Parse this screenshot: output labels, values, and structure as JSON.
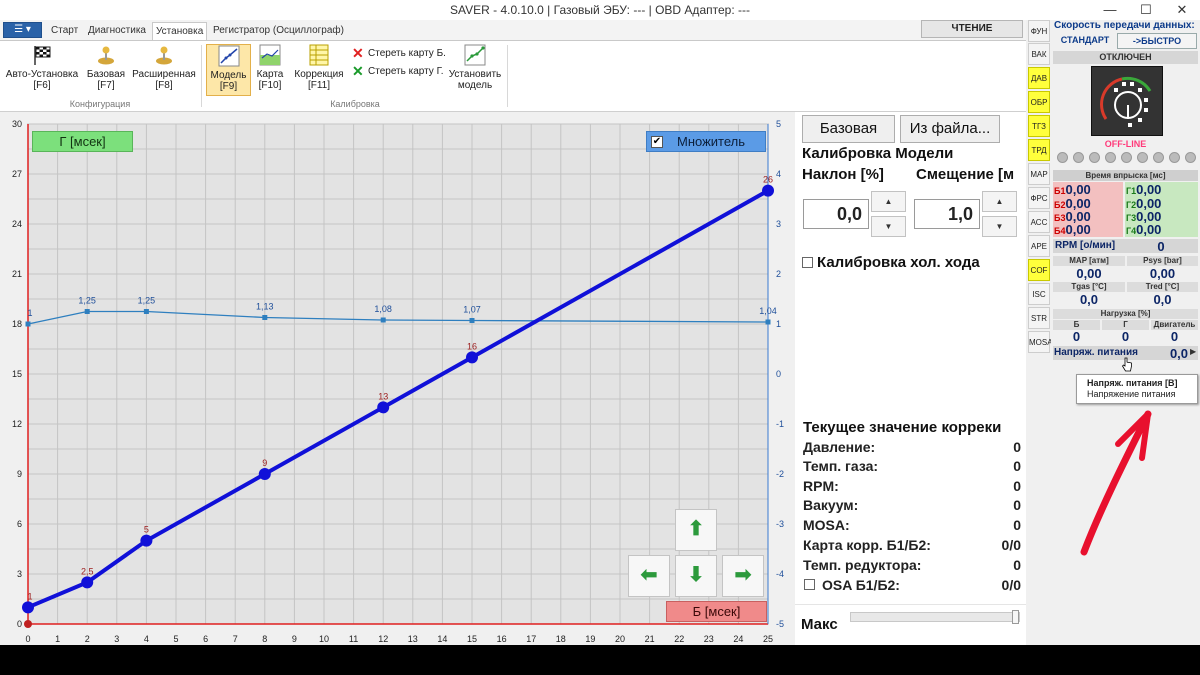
{
  "window": {
    "title": "SAVER - 4.0.10.0  |  Газовый ЭБУ: ---  |  OBD Адаптер: ---",
    "minimize": "—",
    "maximize": "☐",
    "close": "✕"
  },
  "menu": {
    "tabs": [
      "Старт",
      "Диагностика",
      "Установка",
      "Регистратор (Осциллограф)"
    ],
    "read_button": "ЧТЕНИЕ"
  },
  "ribbon": {
    "config_group": "Конфигурация",
    "calib_group": "Калибровка",
    "auto_setup": [
      "Авто-Установка",
      "[F6]"
    ],
    "basic": [
      "Базовая",
      "[F7]"
    ],
    "extended": [
      "Расширенная",
      "[F8]"
    ],
    "model": [
      "Модель",
      "[F9]"
    ],
    "map": [
      "Карта",
      "[F10]"
    ],
    "correction": [
      "Коррекция",
      "[F11]"
    ],
    "erase_b": "Стереть карту Б.",
    "erase_g": "Стереть карту Г.",
    "set_model": [
      "Установить",
      "модель"
    ]
  },
  "chart_labels": {
    "g_axis": "Г [мсек]",
    "b_axis": "Б [мсек]",
    "multiplier": "Множитель",
    "multiplier_checked": "✔"
  },
  "chart_data": {
    "type": "line",
    "xlabel": "Б [мсек]",
    "ylabel": "Г [мсек]",
    "y2label": "Множитель",
    "xlim": [
      0,
      25
    ],
    "ylim": [
      0,
      30
    ],
    "y2lim": [
      -5,
      5
    ],
    "x_ticks": [
      0,
      1,
      2,
      3,
      4,
      5,
      6,
      7,
      8,
      9,
      10,
      11,
      12,
      13,
      14,
      15,
      16,
      17,
      18,
      19,
      20,
      21,
      22,
      23,
      24,
      25
    ],
    "y_ticks": [
      0,
      3,
      6,
      9,
      12,
      15,
      18,
      21,
      24,
      27,
      30
    ],
    "y2_ticks": [
      -5,
      -4,
      -3,
      -2,
      -1,
      0,
      1,
      2,
      3,
      4,
      5
    ],
    "grid": true,
    "series": [
      {
        "name": "Г [мсек]",
        "axis": "left",
        "color": "#1010d8",
        "x": [
          0,
          2,
          4,
          8,
          12,
          15,
          25
        ],
        "y": [
          1,
          2.5,
          5,
          9,
          13,
          16,
          26
        ],
        "labels": [
          "1",
          "2,5",
          "5",
          "9",
          "13",
          "16",
          "26"
        ]
      },
      {
        "name": "Множитель",
        "axis": "right",
        "color": "#2e7fbf",
        "x": [
          0,
          2,
          4,
          8,
          12,
          15,
          25
        ],
        "y": [
          1,
          1.25,
          1.25,
          1.13,
          1.08,
          1.07,
          1.04
        ],
        "labels": [
          "1",
          "1,25",
          "1,25",
          "1,13",
          "1,08",
          "1,07",
          "1,04"
        ]
      }
    ]
  },
  "nav_buttons": {
    "up": "⬆",
    "left": "⬅",
    "down": "⬇",
    "right": "➡"
  },
  "right_panel": {
    "basic_btn": "Базовая",
    "from_file_btn": "Из файла...",
    "calib_title": "Калибровка Модели",
    "slope_label": "Наклон [%]",
    "offset_label": "Смещение [м",
    "slope_value": "0,0",
    "offset_value": "1,0",
    "spin_up": "▲",
    "spin_down": "▼",
    "idle_calib": "Калибровка хол. хода",
    "current_title": "Текущее значение корреки",
    "rows": [
      {
        "label": "Давление:",
        "value": "0"
      },
      {
        "label": "Темп. газа:",
        "value": "0"
      },
      {
        "label": "RPM:",
        "value": "0"
      },
      {
        "label": "Вакуум:",
        "value": "0"
      },
      {
        "label": "MOSA:",
        "value": "0"
      },
      {
        "label": "Карта корр. Б1/Б2:",
        "value": "0/0"
      },
      {
        "label": "Темп. редуктора:",
        "value": "0"
      }
    ],
    "osa_label": "OSA Б1/Б2:",
    "osa_value": "0/0",
    "max_label": "Макс"
  },
  "side_tabs": [
    {
      "label": "ФУН",
      "yellow": false
    },
    {
      "label": "ВАК",
      "yellow": false
    },
    {
      "label": "ДАВ",
      "yellow": true
    },
    {
      "label": "ОБР",
      "yellow": true
    },
    {
      "label": "ТГЗ",
      "yellow": true
    },
    {
      "label": "ТРД",
      "yellow": true
    },
    {
      "label": "MAP",
      "yellow": false
    },
    {
      "label": "ФРС",
      "yellow": false
    },
    {
      "label": "АСС",
      "yellow": false
    },
    {
      "label": "АРЕ",
      "yellow": false
    },
    {
      "label": "COF",
      "yellow": true
    },
    {
      "label": "ISC",
      "yellow": false
    },
    {
      "label": "STR",
      "yellow": false
    },
    {
      "label": "MOSA",
      "yellow": false
    }
  ],
  "device_panel": {
    "speed_title": "Скорость передачи данных:",
    "speed_standard": "СТАНДАРТ",
    "speed_fast": "->БЫСТРО",
    "status_off": "ОТКЛЮЧЕН",
    "offline": "OFF-LINE",
    "injection_title": "Время впрыска [мс]",
    "b1": "Б1",
    "b2": "Б2",
    "b3": "Б3",
    "b4": "Б4",
    "g1": "Г1",
    "g2": "Г2",
    "g3": "Г3",
    "g4": "Г4",
    "inj_value": "0,00",
    "rpm_label": "RPM [о/мин]",
    "rpm_value": "0",
    "map_label": "MAP [атм]",
    "psys_label": "Psys [bar]",
    "map_value": "0,00",
    "psys_value": "0,00",
    "tgas_label": "Tgas [°C]",
    "tred_label": "Tred [°C]",
    "tgas_value": "0,0",
    "tred_value": "0,0",
    "load_label": "Нагрузка [%]",
    "load_b": "Б",
    "load_g": "Г",
    "load_engine": "Двигатель",
    "load_b_value": "0",
    "load_g_value": "0",
    "load_engine_value": "0",
    "voltage_label": "Напряж. питания",
    "voltage_value": "0,0",
    "voltage_arrow": "▶"
  },
  "tooltip": {
    "title": "Напряж. питания  [В]",
    "desc": "Напряжение питания"
  },
  "colors": {
    "model_line": "#1010d8",
    "multiplier_line": "#2e7fbf",
    "marker_label": "#9b1b1b",
    "annotation_arrow": "#e8102e"
  }
}
